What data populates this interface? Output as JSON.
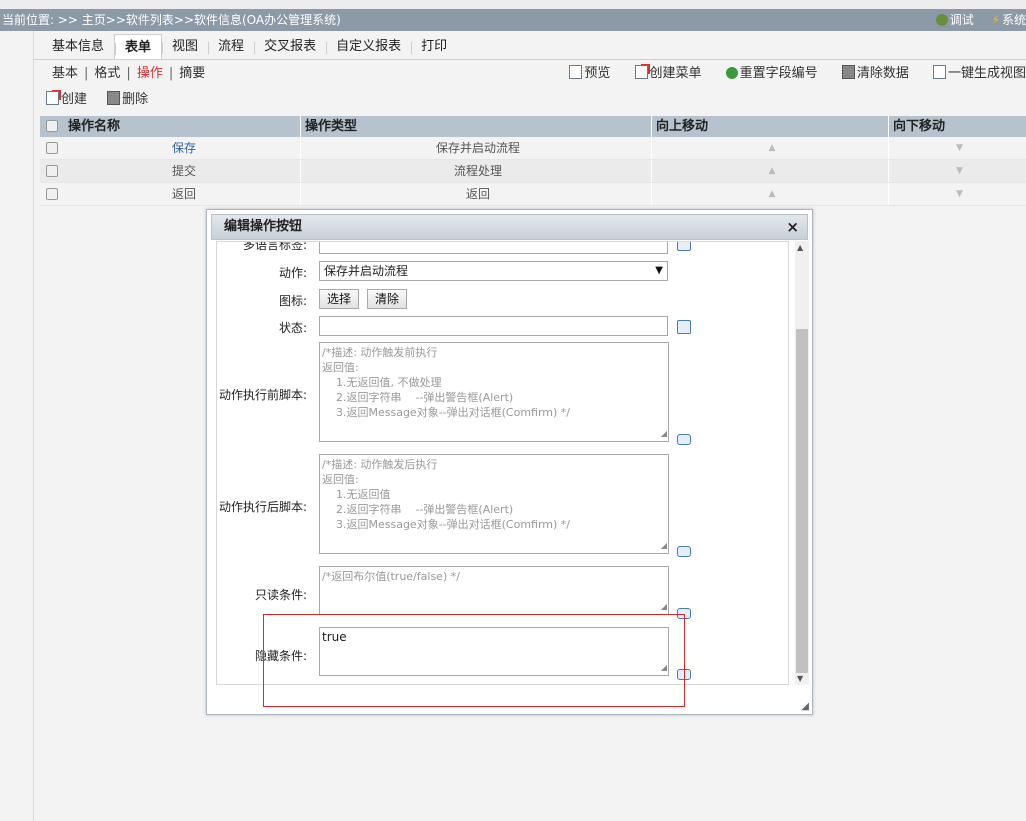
{
  "breadcrumb": {
    "location": "当前位置: >> 主页>>软件列表>>软件信息(OA办公管理系统)",
    "debug_label": "调试",
    "system_label": "系统"
  },
  "tabs": [
    {
      "label": "基本信息",
      "active": false
    },
    {
      "label": "表单",
      "active": true
    },
    {
      "label": "视图",
      "active": false
    },
    {
      "label": "流程",
      "active": false
    },
    {
      "label": "交叉报表",
      "active": false
    },
    {
      "label": "自定义报表",
      "active": false
    },
    {
      "label": "打印",
      "active": false
    }
  ],
  "subtabs": [
    {
      "label": "基本",
      "active": false
    },
    {
      "label": "格式",
      "active": false
    },
    {
      "label": "操作",
      "active": true
    },
    {
      "label": "摘要",
      "active": false
    }
  ],
  "toolbar": {
    "preview": "预览",
    "create_menu": "创建菜单",
    "reset_field_numbers": "重置字段编号",
    "clear_data": "清除数据",
    "generate_view": "一键生成视图"
  },
  "actions": {
    "create": "创建",
    "delete": "删除"
  },
  "grid": {
    "headers": [
      "操作名称",
      "操作类型",
      "向上移动",
      "向下移动"
    ],
    "rows": [
      {
        "name": "保存",
        "type": "保存并启动流程"
      },
      {
        "name": "提交",
        "type": "流程处理"
      },
      {
        "name": "返回",
        "type": "返回"
      }
    ]
  },
  "dialog": {
    "title": "编辑操作按钮",
    "close": "×",
    "fields": {
      "multilang_label": "多语言标签:",
      "action_label": "动作:",
      "action_value": "保存并启动流程",
      "icon_label": "图标:",
      "icon_select_button": "选择",
      "icon_clear_button": "清除",
      "state_label": "状态:",
      "pre_script_label": "动作执行前脚本:",
      "pre_script_placeholder": "/*描述: 动作触发前执行\n返回值:\n    1.无返回值, 不做处理\n    2.返回字符串    --弹出警告框(Alert)\n    3.返回Message对象--弹出对话框(Comfirm) */",
      "post_script_label": "动作执行后脚本:",
      "post_script_placeholder": "/*描述: 动作触发后执行\n返回值:\n    1.无返回值\n    2.返回字符串    --弹出警告框(Alert)\n    3.返回Message对象--弹出对话框(Comfirm) */",
      "readonly_label": "只读条件:",
      "readonly_placeholder": "/*返回布尔值(true/false) */",
      "hidden_label": "隐藏条件:",
      "hidden_value": "true"
    }
  },
  "colors": {
    "location_bar": "#8c9aa8",
    "grid_header": "#b6c2cd",
    "active_subtab": "#d9302c",
    "highlight_box": "#e0262a",
    "link": "#2a62b0"
  }
}
